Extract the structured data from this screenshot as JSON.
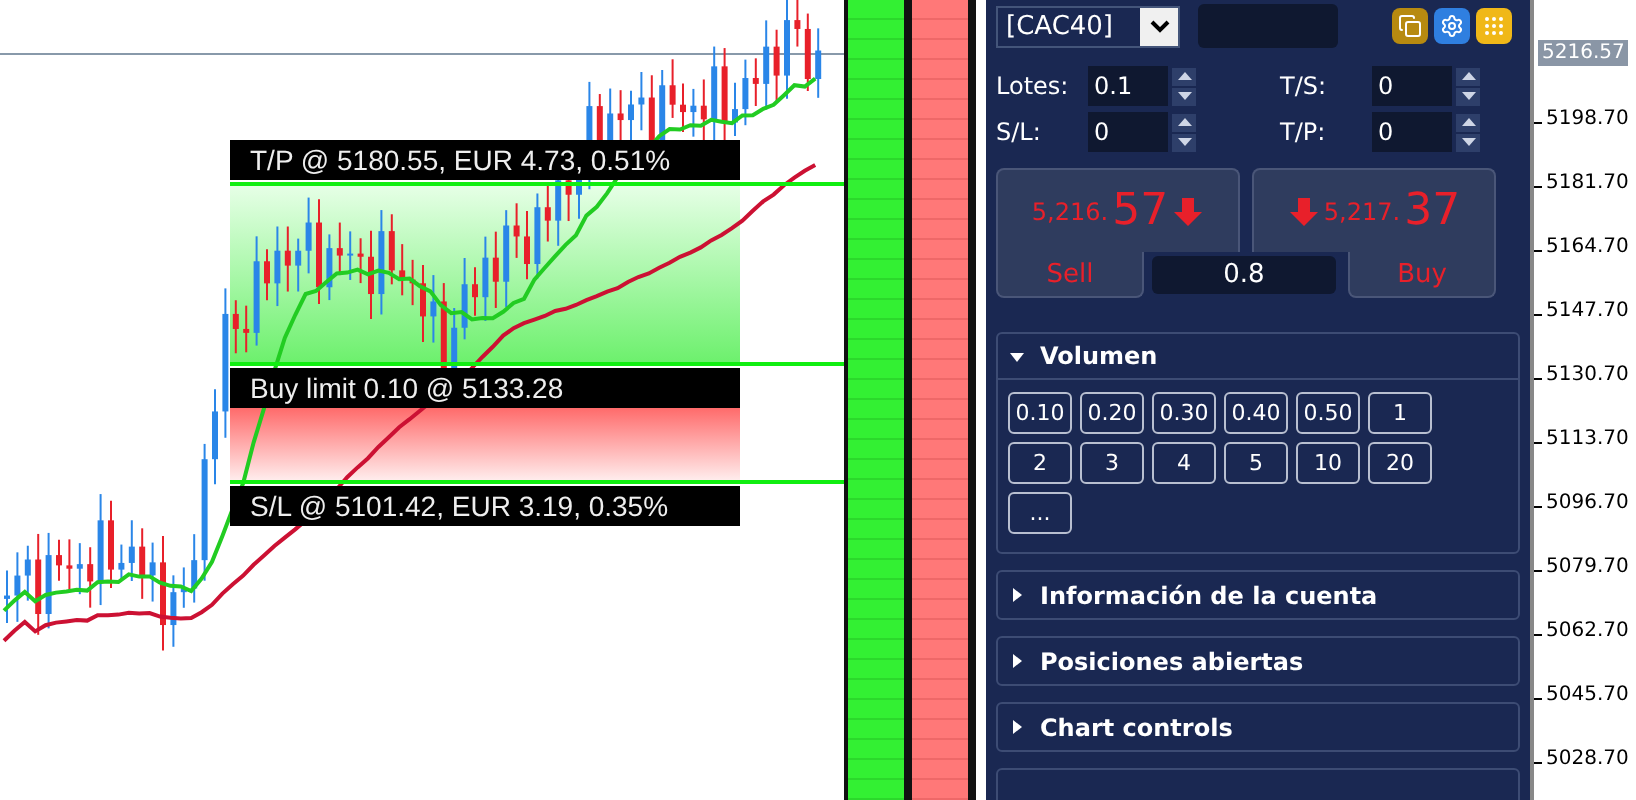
{
  "chart": {
    "orders": [
      {
        "kind": "take-profit",
        "label": "T/P @ 5180.55, EUR 4.73, 0.51%"
      },
      {
        "kind": "entry",
        "label": "Buy limit 0.10 @ 5133.28"
      },
      {
        "kind": "stop-loss",
        "label": "S/L @ 5101.42, EUR 3.19, 0.35%"
      }
    ]
  },
  "panel": {
    "symbol": "[CAC40]",
    "fields": [
      {
        "label": "Lotes:",
        "value": "0.1"
      },
      {
        "label": "T/S:",
        "value": "0"
      },
      {
        "label": "S/L:",
        "value": "0"
      },
      {
        "label": "T/P:",
        "value": "0"
      }
    ],
    "sell": {
      "price_small": "5,216.",
      "price_big": "57",
      "label": "Sell"
    },
    "buy": {
      "price_small": "5,217.",
      "price_big": "37",
      "label": "Buy"
    },
    "spread": "0.8",
    "sections": [
      {
        "title": "Volumen",
        "expanded": true,
        "buttons": [
          "0.10",
          "0.20",
          "0.30",
          "0.40",
          "0.50",
          "1",
          "2",
          "3",
          "4",
          "5",
          "10",
          "20",
          "..."
        ]
      },
      {
        "title": "Información de la cuenta",
        "expanded": false
      },
      {
        "title": "Posiciones abiertas",
        "expanded": false
      },
      {
        "title": "Chart controls",
        "expanded": false
      }
    ]
  },
  "price_axis": {
    "current": "5216.57",
    "ticks": [
      "5198.70",
      "5181.70",
      "5164.70",
      "5147.70",
      "5130.70",
      "5113.70",
      "5096.70",
      "5079.70",
      "5062.70",
      "5045.70",
      "5028.70"
    ]
  }
}
